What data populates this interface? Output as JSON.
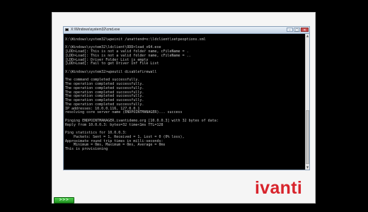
{
  "window": {
    "title": "X:\\Windows\\system32\\cmd.exe",
    "minimize_glyph": "–",
    "maximize_glyph": "□",
    "close_glyph": "✕"
  },
  "scrollbar": {
    "up_glyph": "▲",
    "down_glyph": "▼"
  },
  "console": {
    "lines": [
      "",
      "X:\\Windows\\system32\\wpeinit /unattend=x:\\ldclient\\setpeoptions.xml",
      "",
      "X:\\Windows\\system32\\ldclient\\ODD>load_x64.exe",
      "[LDD>Load]: This is not a valid folder name, cFileName = .",
      "[LDD>Load]: This is not a valid folder name, cFileName = ..",
      "[LDD>Load]: Driver Folder List is empty",
      "[LDD>Load]: Fail to get Driver Inf File List",
      "",
      "X:\\Windows\\system32>wpeutil disablefirewall",
      "",
      "The command completed successfully.",
      "The operation completed successfully.",
      "The operation completed successfully.",
      "The operation completed successfully.",
      "The operation completed successfully.",
      "The operation completed successfully.",
      "The operation completed successfully.",
      "IP addresses: 10.0.0.116, 127.0.0.1",
      "resolving core server name (ENDPOINTMANAGER)... success",
      "",
      "Pinging ENDPOINTMANAGER.ivantidemo.org [10.0.0.3] with 32 bytes of data:",
      "Reply from 10.0.0.3: bytes=32 time<1ms TTL=128",
      "",
      "Ping statistics for 10.0.0.3:",
      "    Packets: Sent = 1, Received = 1, Lost = 0 (0% loss),",
      "Approximate round trip times in milli-seconds:",
      "    Minimum = 0ms, Maximum = 0ms, Average = 0ms",
      "This is provisioning",
      ""
    ]
  },
  "brand": {
    "logo_text": "ivanti",
    "color": "#d8242c"
  },
  "progress": {
    "label": ">>>",
    "color": "#2fb12f"
  }
}
